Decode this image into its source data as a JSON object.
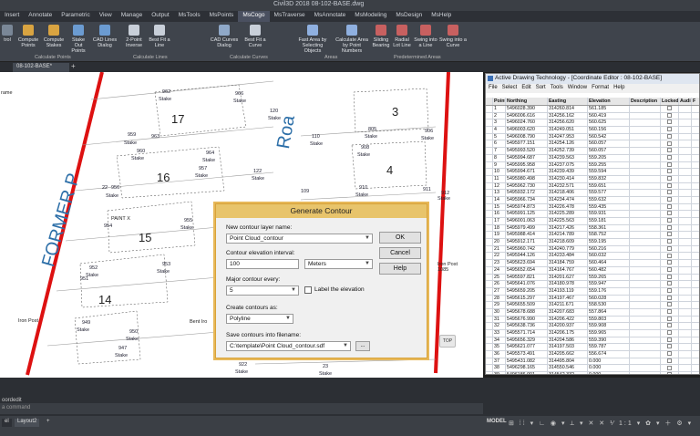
{
  "window": {
    "title": "Civil3D 2018  08-102-BASE.dwg"
  },
  "menu_tabs": [
    "Insert",
    "Annotate",
    "Parametric",
    "View",
    "Manage",
    "Output",
    "MsTools",
    "MsPoints",
    "MsCogo",
    "MsTraverse",
    "MsAnnotate",
    "MsModeling",
    "MsDesign",
    "MsHelp"
  ],
  "active_tab": "MsCogo",
  "ribbon": {
    "buttons": [
      "trol",
      "Compute Points",
      "Compute Stakes",
      "Stake Out Points",
      "CAD Lines Dialog",
      "2-Point Inverse",
      "Best Fit a Line",
      "CAD Curves Dialog",
      "Best Fit a Curve",
      "Fast Area by Selecting Objects",
      "Calculate Area by Point Numbers",
      "Sliding Bearing",
      "Radial Lot Line",
      "Swing into a Line",
      "Swing into a Curve"
    ],
    "panels": [
      "Calculate Points",
      "Calculate Lines",
      "Calculate Curves",
      "Areas",
      "Predetermined Areas"
    ]
  },
  "doc_tab": "08-102-BASE*",
  "canvas": {
    "frame_label": "rame",
    "lots": [
      "17",
      "16",
      "15",
      "14",
      "3",
      "4"
    ],
    "road_labels": [
      "FORMER P",
      "Roa"
    ],
    "stake_label": "Stake",
    "point_numbers": [
      "962",
      "966",
      "120",
      "959",
      "963",
      "964",
      "960",
      "957",
      "122",
      "956",
      "955",
      "954",
      "953",
      "952",
      "951",
      "949",
      "950",
      "947",
      "945",
      "110",
      "805",
      "906",
      "908",
      "909",
      "910",
      "911",
      "912",
      "913",
      "109",
      "106",
      "902",
      "903",
      "128",
      "922",
      "23",
      "22"
    ],
    "text_labels": [
      "PAINT X",
      "Iron Post",
      "Bent Iro",
      "Iron Post 1085"
    ],
    "top_button": "TOP"
  },
  "dialog": {
    "title": "Generate Contour",
    "layer_label": "New contour layer name:",
    "layer_value": "Point Cloud_contour",
    "interval_label": "Contour elevation interval:",
    "interval_value": "100",
    "unit_value": "Meters",
    "major_label": "Major contour every:",
    "major_value": "5",
    "label_elevation": "Label the elevation",
    "create_label": "Create contours as:",
    "create_value": "Polyline",
    "save_label": "Save contours into filename:",
    "save_value": "C:\\template\\Point Cloud_contour.sdf",
    "browse": "...",
    "ok": "OK",
    "cancel": "Cancel",
    "help": "Help"
  },
  "coord_editor": {
    "title": "Active Drawing Technology - [Coordinate Editor : 08-102-BASE]",
    "menu": [
      "File",
      "Select",
      "Edit",
      "Sort",
      "Tools",
      "Window",
      "Format",
      "Help"
    ],
    "columns": [
      "Point",
      "Northing",
      "Easting",
      "Elevation",
      "Description",
      "Locked",
      "Audio",
      "F"
    ],
    "rows": [
      [
        "1",
        "5496028.390",
        "314260.814",
        "561.185"
      ],
      [
        "2",
        "5496006.616",
        "314256.162",
        "560.419"
      ],
      [
        "3",
        "5496024.760",
        "314256.620",
        "560.625"
      ],
      [
        "4",
        "5496003.620",
        "314249.051",
        "560.156"
      ],
      [
        "5",
        "5496008.790",
        "314247.953",
        "560.542"
      ],
      [
        "6",
        "5495977.151",
        "314254.126",
        "560.057"
      ],
      [
        "7",
        "5495993.520",
        "314252.739",
        "560.057"
      ],
      [
        "8",
        "5495994.687",
        "314239.563",
        "559.205"
      ],
      [
        "9",
        "5495995.958",
        "314237.075",
        "559.255"
      ],
      [
        "10",
        "5495994.671",
        "314239.439",
        "559.594"
      ],
      [
        "11",
        "5495980.498",
        "314230.414",
        "559.832"
      ],
      [
        "12",
        "5495962.730",
        "314232.571",
        "559.651"
      ],
      [
        "13",
        "5495932.172",
        "314218.406",
        "559.577"
      ],
      [
        "14",
        "5495966.734",
        "314234.474",
        "559.632"
      ],
      [
        "15",
        "5495974.873",
        "314226.478",
        "559.435"
      ],
      [
        "16",
        "5495991.125",
        "314225.289",
        "559.931"
      ],
      [
        "17",
        "5496001.063",
        "314225.563",
        "559.181"
      ],
      [
        "18",
        "5495979.499",
        "314217.426",
        "558.361"
      ],
      [
        "19",
        "5495988.414",
        "314214.789",
        "558.752"
      ],
      [
        "20",
        "5495912.171",
        "314218.609",
        "559.195"
      ],
      [
        "21",
        "5495960.742",
        "314240.779",
        "560.216"
      ],
      [
        "22",
        "5495944.126",
        "314233.484",
        "560.032"
      ],
      [
        "23",
        "5495623.694",
        "314184.759",
        "560.464"
      ],
      [
        "24",
        "5495652.654",
        "314164.767",
        "560.482"
      ],
      [
        "25",
        "5495597.821",
        "314201.627",
        "559.265"
      ],
      [
        "26",
        "5495641.076",
        "314180.978",
        "559.947"
      ],
      [
        "27",
        "5495659.205",
        "314193.119",
        "559.176"
      ],
      [
        "28",
        "5495615.297",
        "314197.467",
        "560.028"
      ],
      [
        "29",
        "5495655.509",
        "314211.671",
        "558.530"
      ],
      [
        "30",
        "5495678.688",
        "314207.683",
        "557.864"
      ],
      [
        "31",
        "5495676.990",
        "314206.422",
        "559.803"
      ],
      [
        "32",
        "5495638.736",
        "314200.937",
        "559.908"
      ],
      [
        "33",
        "5495571.714",
        "314206.175",
        "559.965"
      ],
      [
        "34",
        "5495656.329",
        "314204.586",
        "559.390"
      ],
      [
        "35",
        "5495621.077",
        "314197.503",
        "559.787"
      ],
      [
        "36",
        "5495573.491",
        "314205.662",
        "556.674"
      ],
      [
        "37",
        "5495431.082",
        "314495.804",
        "0.000"
      ],
      [
        "38",
        "5496298.165",
        "314550.546",
        "0.000"
      ],
      [
        "39",
        "5496186.001",
        "314542.332",
        "0.000"
      ],
      [
        "39",
        "5495734.263",
        "314168.336",
        "563.501"
      ]
    ],
    "selected_row": 39
  },
  "command": {
    "last": "oordedit",
    "prompt": "a command"
  },
  "status": {
    "layouts": [
      "el",
      "Layout2"
    ],
    "plus": "+",
    "model": "MODEL",
    "icons": "⊞ ⁞⁞ ▾ ∟ ◉ ▾ ⟂ ▾ ✕ ✕ ⅟ 1:1 ▾ ✿ ▾ ＋ ⚙ ▾"
  }
}
